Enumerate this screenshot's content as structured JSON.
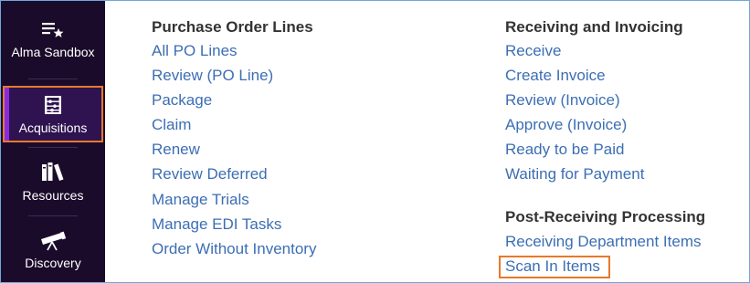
{
  "sidebar": {
    "items": [
      {
        "label": "Alma Sandbox",
        "icon": "list-star-icon"
      },
      {
        "label": "Acquisitions",
        "icon": "abacus-icon",
        "active": true
      },
      {
        "label": "Resources",
        "icon": "books-icon"
      },
      {
        "label": "Discovery",
        "icon": "telescope-icon"
      }
    ],
    "background": "#1b0b2b",
    "active_background": "#2f1350",
    "highlight_color": "#e8792b"
  },
  "menu": {
    "purchase_order_lines": {
      "heading": "Purchase Order Lines",
      "links": [
        "All PO Lines",
        "Review (PO Line)",
        "Package",
        "Claim",
        "Renew",
        "Review Deferred",
        "Manage Trials",
        "Manage EDI Tasks",
        "Order Without Inventory"
      ]
    },
    "receiving_and_invoicing": {
      "heading": "Receiving and Invoicing",
      "links": [
        "Receive",
        "Create Invoice",
        "Review (Invoice)",
        "Approve (Invoice)",
        "Ready to be Paid",
        "Waiting for Payment"
      ]
    },
    "post_receiving_processing": {
      "heading": "Post-Receiving Processing",
      "links": [
        "Receiving Department Items",
        "Scan In Items"
      ]
    },
    "link_color": "#3c6eb4",
    "heading_color": "#333333"
  }
}
